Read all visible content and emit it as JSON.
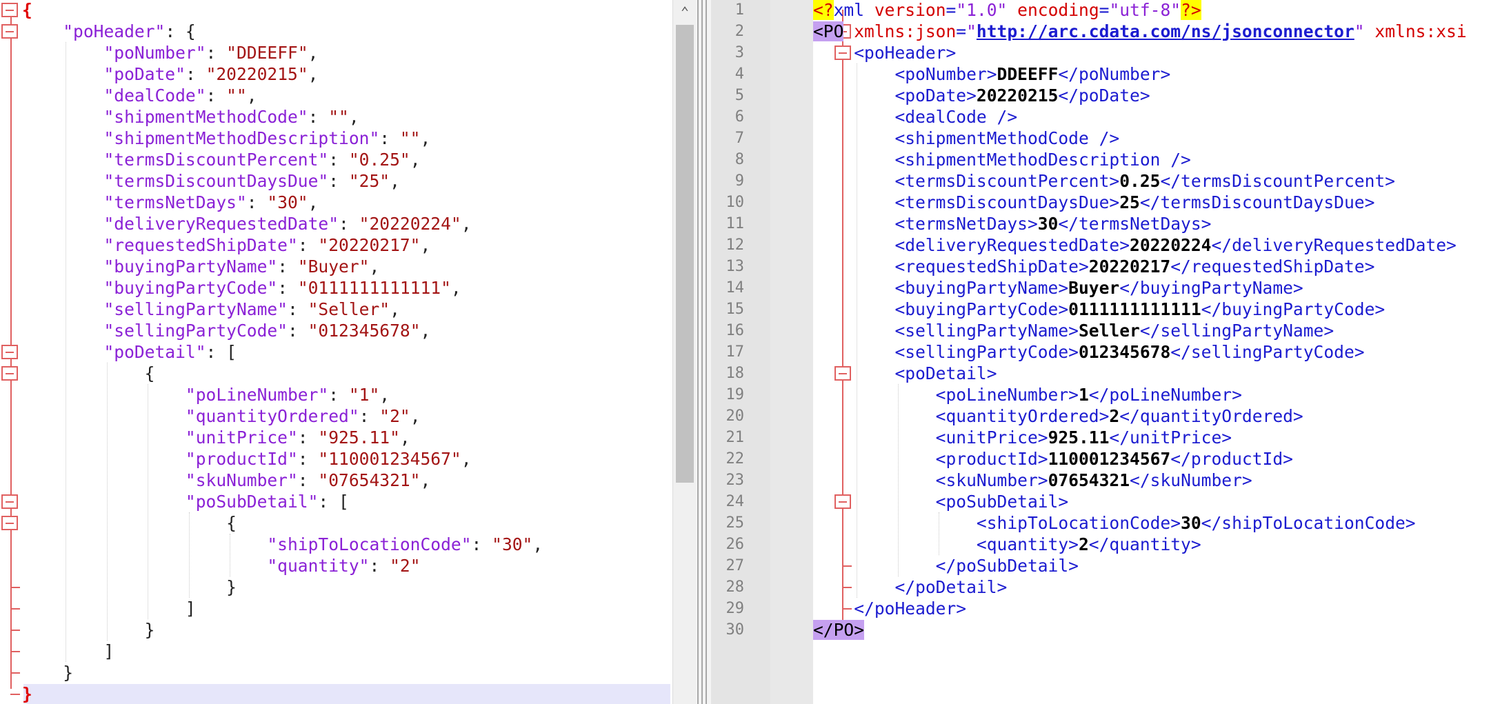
{
  "json_pane": {
    "lines": [
      [
        {
          "t": "{",
          "c": "bold-red"
        }
      ],
      [
        {
          "t": "    ",
          "c": "p"
        },
        {
          "t": "\"poHeader\"",
          "c": "k"
        },
        {
          "t": ": {",
          "c": "p"
        }
      ],
      [
        {
          "t": "        ",
          "c": "p"
        },
        {
          "t": "\"poNumber\"",
          "c": "k"
        },
        {
          "t": ": ",
          "c": "p"
        },
        {
          "t": "\"DDEEFF\"",
          "c": "v"
        },
        {
          "t": ",",
          "c": "p"
        }
      ],
      [
        {
          "t": "        ",
          "c": "p"
        },
        {
          "t": "\"poDate\"",
          "c": "k"
        },
        {
          "t": ": ",
          "c": "p"
        },
        {
          "t": "\"20220215\"",
          "c": "v"
        },
        {
          "t": ",",
          "c": "p"
        }
      ],
      [
        {
          "t": "        ",
          "c": "p"
        },
        {
          "t": "\"dealCode\"",
          "c": "k"
        },
        {
          "t": ": ",
          "c": "p"
        },
        {
          "t": "\"\"",
          "c": "v"
        },
        {
          "t": ",",
          "c": "p"
        }
      ],
      [
        {
          "t": "        ",
          "c": "p"
        },
        {
          "t": "\"shipmentMethodCode\"",
          "c": "k"
        },
        {
          "t": ": ",
          "c": "p"
        },
        {
          "t": "\"\"",
          "c": "v"
        },
        {
          "t": ",",
          "c": "p"
        }
      ],
      [
        {
          "t": "        ",
          "c": "p"
        },
        {
          "t": "\"shipmentMethodDescription\"",
          "c": "k"
        },
        {
          "t": ": ",
          "c": "p"
        },
        {
          "t": "\"\"",
          "c": "v"
        },
        {
          "t": ",",
          "c": "p"
        }
      ],
      [
        {
          "t": "        ",
          "c": "p"
        },
        {
          "t": "\"termsDiscountPercent\"",
          "c": "k"
        },
        {
          "t": ": ",
          "c": "p"
        },
        {
          "t": "\"0.25\"",
          "c": "v"
        },
        {
          "t": ",",
          "c": "p"
        }
      ],
      [
        {
          "t": "        ",
          "c": "p"
        },
        {
          "t": "\"termsDiscountDaysDue\"",
          "c": "k"
        },
        {
          "t": ": ",
          "c": "p"
        },
        {
          "t": "\"25\"",
          "c": "v"
        },
        {
          "t": ",",
          "c": "p"
        }
      ],
      [
        {
          "t": "        ",
          "c": "p"
        },
        {
          "t": "\"termsNetDays\"",
          "c": "k"
        },
        {
          "t": ": ",
          "c": "p"
        },
        {
          "t": "\"30\"",
          "c": "v"
        },
        {
          "t": ",",
          "c": "p"
        }
      ],
      [
        {
          "t": "        ",
          "c": "p"
        },
        {
          "t": "\"deliveryRequestedDate\"",
          "c": "k"
        },
        {
          "t": ": ",
          "c": "p"
        },
        {
          "t": "\"20220224\"",
          "c": "v"
        },
        {
          "t": ",",
          "c": "p"
        }
      ],
      [
        {
          "t": "        ",
          "c": "p"
        },
        {
          "t": "\"requestedShipDate\"",
          "c": "k"
        },
        {
          "t": ": ",
          "c": "p"
        },
        {
          "t": "\"20220217\"",
          "c": "v"
        },
        {
          "t": ",",
          "c": "p"
        }
      ],
      [
        {
          "t": "        ",
          "c": "p"
        },
        {
          "t": "\"buyingPartyName\"",
          "c": "k"
        },
        {
          "t": ": ",
          "c": "p"
        },
        {
          "t": "\"Buyer\"",
          "c": "v"
        },
        {
          "t": ",",
          "c": "p"
        }
      ],
      [
        {
          "t": "        ",
          "c": "p"
        },
        {
          "t": "\"buyingPartyCode\"",
          "c": "k"
        },
        {
          "t": ": ",
          "c": "p"
        },
        {
          "t": "\"0111111111111\"",
          "c": "v"
        },
        {
          "t": ",",
          "c": "p"
        }
      ],
      [
        {
          "t": "        ",
          "c": "p"
        },
        {
          "t": "\"sellingPartyName\"",
          "c": "k"
        },
        {
          "t": ": ",
          "c": "p"
        },
        {
          "t": "\"Seller\"",
          "c": "v"
        },
        {
          "t": ",",
          "c": "p"
        }
      ],
      [
        {
          "t": "        ",
          "c": "p"
        },
        {
          "t": "\"sellingPartyCode\"",
          "c": "k"
        },
        {
          "t": ": ",
          "c": "p"
        },
        {
          "t": "\"012345678\"",
          "c": "v"
        },
        {
          "t": ",",
          "c": "p"
        }
      ],
      [
        {
          "t": "        ",
          "c": "p"
        },
        {
          "t": "\"poDetail\"",
          "c": "k"
        },
        {
          "t": ": [",
          "c": "p"
        }
      ],
      [
        {
          "t": "            {",
          "c": "p"
        }
      ],
      [
        {
          "t": "                ",
          "c": "p"
        },
        {
          "t": "\"poLineNumber\"",
          "c": "k"
        },
        {
          "t": ": ",
          "c": "p"
        },
        {
          "t": "\"1\"",
          "c": "v"
        },
        {
          "t": ",",
          "c": "p"
        }
      ],
      [
        {
          "t": "                ",
          "c": "p"
        },
        {
          "t": "\"quantityOrdered\"",
          "c": "k"
        },
        {
          "t": ": ",
          "c": "p"
        },
        {
          "t": "\"2\"",
          "c": "v"
        },
        {
          "t": ",",
          "c": "p"
        }
      ],
      [
        {
          "t": "                ",
          "c": "p"
        },
        {
          "t": "\"unitPrice\"",
          "c": "k"
        },
        {
          "t": ": ",
          "c": "p"
        },
        {
          "t": "\"925.11\"",
          "c": "v"
        },
        {
          "t": ",",
          "c": "p"
        }
      ],
      [
        {
          "t": "                ",
          "c": "p"
        },
        {
          "t": "\"productId\"",
          "c": "k"
        },
        {
          "t": ": ",
          "c": "p"
        },
        {
          "t": "\"110001234567\"",
          "c": "v"
        },
        {
          "t": ",",
          "c": "p"
        }
      ],
      [
        {
          "t": "                ",
          "c": "p"
        },
        {
          "t": "\"skuNumber\"",
          "c": "k"
        },
        {
          "t": ": ",
          "c": "p"
        },
        {
          "t": "\"07654321\"",
          "c": "v"
        },
        {
          "t": ",",
          "c": "p"
        }
      ],
      [
        {
          "t": "                ",
          "c": "p"
        },
        {
          "t": "\"poSubDetail\"",
          "c": "k"
        },
        {
          "t": ": [",
          "c": "p"
        }
      ],
      [
        {
          "t": "                    {",
          "c": "p"
        }
      ],
      [
        {
          "t": "                        ",
          "c": "p"
        },
        {
          "t": "\"shipToLocationCode\"",
          "c": "k"
        },
        {
          "t": ": ",
          "c": "p"
        },
        {
          "t": "\"30\"",
          "c": "v"
        },
        {
          "t": ",",
          "c": "p"
        }
      ],
      [
        {
          "t": "                        ",
          "c": "p"
        },
        {
          "t": "\"quantity\"",
          "c": "k"
        },
        {
          "t": ": ",
          "c": "p"
        },
        {
          "t": "\"2\"",
          "c": "v"
        }
      ],
      [
        {
          "t": "                    }",
          "c": "p"
        }
      ],
      [
        {
          "t": "                ]",
          "c": "p"
        }
      ],
      [
        {
          "t": "            }",
          "c": "p"
        }
      ],
      [
        {
          "t": "        ]",
          "c": "p"
        }
      ],
      [
        {
          "t": "    }",
          "c": "p"
        }
      ],
      [
        {
          "t": "}",
          "c": "bold-red"
        }
      ]
    ]
  },
  "xml_pane": {
    "line_numbers": [
      "1",
      "2",
      "3",
      "4",
      "5",
      "6",
      "7",
      "8",
      "9",
      "10",
      "11",
      "12",
      "13",
      "14",
      "15",
      "16",
      "17",
      "18",
      "19",
      "20",
      "21",
      "22",
      "23",
      "24",
      "25",
      "26",
      "27",
      "28",
      "29",
      "30"
    ],
    "lines": [
      [
        {
          "t": "<?",
          "c": "pi"
        },
        {
          "t": "xml ",
          "c": "t"
        },
        {
          "t": "version",
          "c": "an"
        },
        {
          "t": "=",
          "c": "t"
        },
        {
          "t": "\"1.0\"",
          "c": "av"
        },
        {
          "t": " encoding",
          "c": "an"
        },
        {
          "t": "=",
          "c": "t"
        },
        {
          "t": "\"utf-8\"",
          "c": "av"
        },
        {
          "t": "?>",
          "c": "pi"
        }
      ],
      [
        {
          "t": "<PO",
          "c": "hl-tag"
        },
        {
          "t": " xmlns:json",
          "c": "an"
        },
        {
          "t": "=",
          "c": "t"
        },
        {
          "t": "\"",
          "c": "av"
        },
        {
          "t": "http://arc.cdata.com/ns/jsonconnector",
          "c": "url"
        },
        {
          "t": "\"",
          "c": "av"
        },
        {
          "t": " xmlns:xsi",
          "c": "an"
        }
      ],
      [
        {
          "t": "    <poHeader>",
          "c": "t"
        }
      ],
      [
        {
          "t": "        <poNumber>",
          "c": "t"
        },
        {
          "t": "DDEEFF",
          "c": "tv"
        },
        {
          "t": "</poNumber>",
          "c": "t"
        }
      ],
      [
        {
          "t": "        <poDate>",
          "c": "t"
        },
        {
          "t": "20220215",
          "c": "tv"
        },
        {
          "t": "</poDate>",
          "c": "t"
        }
      ],
      [
        {
          "t": "        <dealCode />",
          "c": "t"
        }
      ],
      [
        {
          "t": "        <shipmentMethodCode />",
          "c": "t"
        }
      ],
      [
        {
          "t": "        <shipmentMethodDescription />",
          "c": "t"
        }
      ],
      [
        {
          "t": "        <termsDiscountPercent>",
          "c": "t"
        },
        {
          "t": "0.25",
          "c": "tv"
        },
        {
          "t": "</termsDiscountPercent>",
          "c": "t"
        }
      ],
      [
        {
          "t": "        <termsDiscountDaysDue>",
          "c": "t"
        },
        {
          "t": "25",
          "c": "tv"
        },
        {
          "t": "</termsDiscountDaysDue>",
          "c": "t"
        }
      ],
      [
        {
          "t": "        <termsNetDays>",
          "c": "t"
        },
        {
          "t": "30",
          "c": "tv"
        },
        {
          "t": "</termsNetDays>",
          "c": "t"
        }
      ],
      [
        {
          "t": "        <deliveryRequestedDate>",
          "c": "t"
        },
        {
          "t": "20220224",
          "c": "tv"
        },
        {
          "t": "</deliveryRequestedDate>",
          "c": "t"
        }
      ],
      [
        {
          "t": "        <requestedShipDate>",
          "c": "t"
        },
        {
          "t": "20220217",
          "c": "tv"
        },
        {
          "t": "</requestedShipDate>",
          "c": "t"
        }
      ],
      [
        {
          "t": "        <buyingPartyName>",
          "c": "t"
        },
        {
          "t": "Buyer",
          "c": "tv"
        },
        {
          "t": "</buyingPartyName>",
          "c": "t"
        }
      ],
      [
        {
          "t": "        <buyingPartyCode>",
          "c": "t"
        },
        {
          "t": "0111111111111",
          "c": "tv"
        },
        {
          "t": "</buyingPartyCode>",
          "c": "t"
        }
      ],
      [
        {
          "t": "        <sellingPartyName>",
          "c": "t"
        },
        {
          "t": "Seller",
          "c": "tv"
        },
        {
          "t": "</sellingPartyName>",
          "c": "t"
        }
      ],
      [
        {
          "t": "        <sellingPartyCode>",
          "c": "t"
        },
        {
          "t": "012345678",
          "c": "tv"
        },
        {
          "t": "</sellingPartyCode>",
          "c": "t"
        }
      ],
      [
        {
          "t": "        <poDetail>",
          "c": "t"
        }
      ],
      [
        {
          "t": "            <poLineNumber>",
          "c": "t"
        },
        {
          "t": "1",
          "c": "tv"
        },
        {
          "t": "</poLineNumber>",
          "c": "t"
        }
      ],
      [
        {
          "t": "            <quantityOrdered>",
          "c": "t"
        },
        {
          "t": "2",
          "c": "tv"
        },
        {
          "t": "</quantityOrdered>",
          "c": "t"
        }
      ],
      [
        {
          "t": "            <unitPrice>",
          "c": "t"
        },
        {
          "t": "925.11",
          "c": "tv"
        },
        {
          "t": "</unitPrice>",
          "c": "t"
        }
      ],
      [
        {
          "t": "            <productId>",
          "c": "t"
        },
        {
          "t": "110001234567",
          "c": "tv"
        },
        {
          "t": "</productId>",
          "c": "t"
        }
      ],
      [
        {
          "t": "            <skuNumber>",
          "c": "t"
        },
        {
          "t": "07654321",
          "c": "tv"
        },
        {
          "t": "</skuNumber>",
          "c": "t"
        }
      ],
      [
        {
          "t": "            <poSubDetail>",
          "c": "t"
        }
      ],
      [
        {
          "t": "                <shipToLocationCode>",
          "c": "t"
        },
        {
          "t": "30",
          "c": "tv"
        },
        {
          "t": "</shipToLocationCode>",
          "c": "t"
        }
      ],
      [
        {
          "t": "                <quantity>",
          "c": "t"
        },
        {
          "t": "2",
          "c": "tv"
        },
        {
          "t": "</quantity>",
          "c": "t"
        }
      ],
      [
        {
          "t": "            </poSubDetail>",
          "c": "t"
        }
      ],
      [
        {
          "t": "        </poDetail>",
          "c": "t"
        }
      ],
      [
        {
          "t": "    </poHeader>",
          "c": "t"
        }
      ],
      [
        {
          "t": "</PO>",
          "c": "hl-tag"
        }
      ]
    ]
  },
  "colors": {
    "json_key": "#8b22d6",
    "json_value": "#a31515",
    "xml_tag": "#1c1cd0",
    "xml_attr_name": "#d30000",
    "xml_attr_value": "#8b22d6",
    "fold_marker": "#e06060",
    "current_line": "#e6e6fa",
    "pi_highlight": "#ffff00",
    "tag_highlight": "#c5a0f0"
  },
  "icons": {
    "scroll_up": "chevron-up-icon"
  }
}
